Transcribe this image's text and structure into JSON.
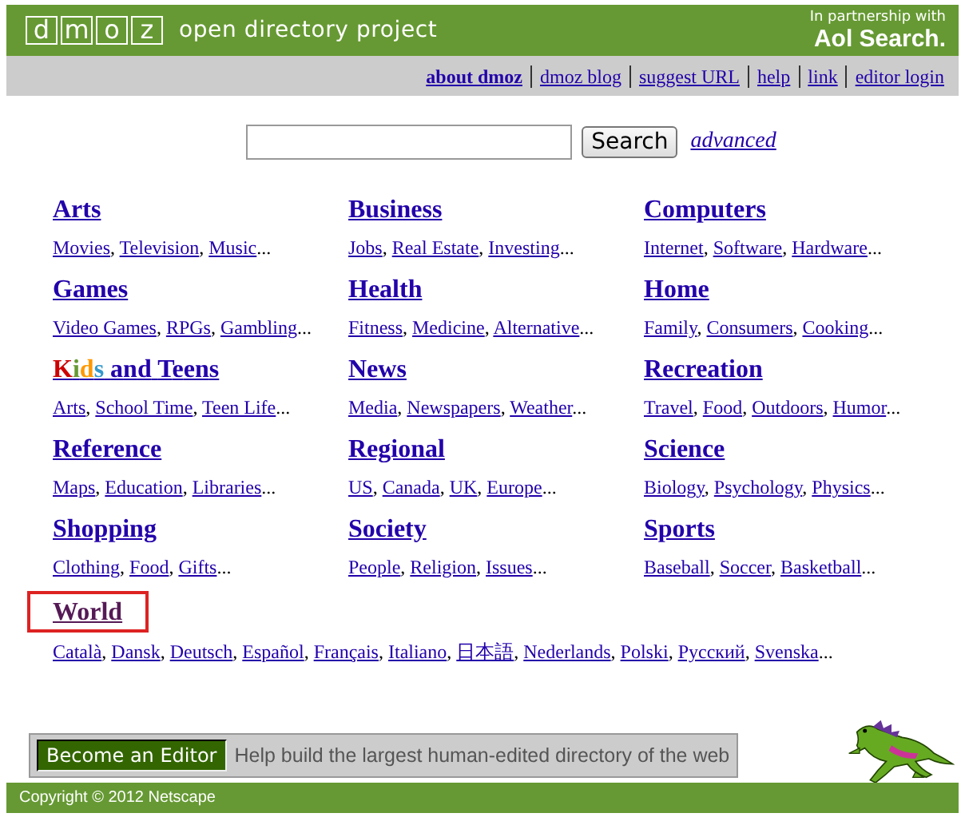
{
  "header": {
    "logo_letters": [
      "d",
      "m",
      "o",
      "z"
    ],
    "tagline": "open directory project",
    "partner_line": "In partnership with",
    "partner_brand": "Aol Search."
  },
  "nav": [
    {
      "label": "about dmoz",
      "bold": true
    },
    {
      "label": "dmoz blog",
      "bold": false
    },
    {
      "label": "suggest URL",
      "bold": false
    },
    {
      "label": "help",
      "bold": false
    },
    {
      "label": "link",
      "bold": false
    },
    {
      "label": "editor login",
      "bold": false
    }
  ],
  "search": {
    "button": "Search",
    "advanced": "advanced"
  },
  "categories": [
    {
      "title": "Arts",
      "kind": "plain",
      "subs": [
        {
          "label": "Movies",
          "after": ","
        },
        {
          "label": "Television",
          "after": ","
        },
        {
          "label": "Music",
          "after": "..."
        }
      ]
    },
    {
      "title": "Business",
      "kind": "plain",
      "subs": [
        {
          "label": "Jobs",
          "after": ","
        },
        {
          "label": "Real Estate",
          "after": ","
        },
        {
          "label": "Investing",
          "after": "..."
        }
      ]
    },
    {
      "title": "Computers",
      "kind": "plain",
      "subs": [
        {
          "label": "Internet",
          "after": ","
        },
        {
          "label": "Software",
          "after": ","
        },
        {
          "label": "Hardware",
          "after": "..."
        }
      ]
    },
    {
      "title": "Games",
      "kind": "plain",
      "subs": [
        {
          "label": "Video Games",
          "after": ","
        },
        {
          "label": "RPGs",
          "after": ","
        },
        {
          "label": "Gambling",
          "after": "..."
        }
      ]
    },
    {
      "title": "Health",
      "kind": "plain",
      "subs": [
        {
          "label": "Fitness",
          "after": ","
        },
        {
          "label": "Medicine",
          "after": ","
        },
        {
          "label": "Alternative",
          "after": "..."
        }
      ]
    },
    {
      "title": "Home",
      "kind": "plain",
      "subs": [
        {
          "label": "Family",
          "after": ","
        },
        {
          "label": "Consumers",
          "after": ","
        },
        {
          "label": "Cooking",
          "after": "..."
        }
      ]
    },
    {
      "title": "Kids and Teens",
      "kind": "rainbow",
      "subs": [
        {
          "label": "Arts",
          "after": ","
        },
        {
          "label": "School Time",
          "after": ","
        },
        {
          "label": "Teen Life",
          "after": "..."
        }
      ]
    },
    {
      "title": "News",
      "kind": "plain",
      "subs": [
        {
          "label": "Media",
          "after": ","
        },
        {
          "label": "Newspapers",
          "after": ","
        },
        {
          "label": "Weather",
          "after": "..."
        }
      ]
    },
    {
      "title": "Recreation",
      "kind": "plain",
      "subs": [
        {
          "label": "Travel",
          "after": ","
        },
        {
          "label": "Food",
          "after": ","
        },
        {
          "label": "Outdoors",
          "after": ","
        },
        {
          "label": "Humor",
          "after": "..."
        }
      ]
    },
    {
      "title": "Reference",
      "kind": "plain",
      "subs": [
        {
          "label": "Maps",
          "after": ","
        },
        {
          "label": "Education",
          "after": ","
        },
        {
          "label": "Libraries",
          "after": "..."
        }
      ]
    },
    {
      "title": "Regional",
      "kind": "plain",
      "subs": [
        {
          "label": "US",
          "after": ","
        },
        {
          "label": "Canada",
          "after": ","
        },
        {
          "label": "UK",
          "after": ","
        },
        {
          "label": "Europe",
          "after": "..."
        }
      ]
    },
    {
      "title": "Science",
      "kind": "plain",
      "subs": [
        {
          "label": "Biology",
          "after": ","
        },
        {
          "label": "Psychology",
          "after": ","
        },
        {
          "label": "Physics",
          "after": "..."
        }
      ]
    },
    {
      "title": "Shopping",
      "kind": "plain",
      "subs": [
        {
          "label": "Clothing",
          "after": ","
        },
        {
          "label": "Food",
          "after": ","
        },
        {
          "label": "Gifts",
          "after": "..."
        }
      ]
    },
    {
      "title": "Society",
      "kind": "plain",
      "subs": [
        {
          "label": "People",
          "after": ","
        },
        {
          "label": "Religion",
          "after": ","
        },
        {
          "label": "Issues",
          "after": "..."
        }
      ]
    },
    {
      "title": "Sports",
      "kind": "plain",
      "subs": [
        {
          "label": "Baseball",
          "after": ","
        },
        {
          "label": "Soccer",
          "after": ","
        },
        {
          "label": "Basketball",
          "after": "..."
        }
      ]
    }
  ],
  "world": {
    "title": "World",
    "highlighted": true,
    "subs": [
      {
        "label": "Català",
        "after": ","
      },
      {
        "label": "Dansk",
        "after": ","
      },
      {
        "label": "Deutsch",
        "after": ","
      },
      {
        "label": "Español",
        "after": ","
      },
      {
        "label": "Français",
        "after": ","
      },
      {
        "label": "Italiano",
        "after": ","
      },
      {
        "label": "日本語",
        "after": ","
      },
      {
        "label": "Nederlands",
        "after": ","
      },
      {
        "label": "Polski",
        "after": ","
      },
      {
        "label": "Русский",
        "after": ","
      },
      {
        "label": "Svenska",
        "after": "..."
      }
    ]
  },
  "editor_banner": {
    "button": "Become an Editor",
    "text": "Help build the largest human-edited directory of the web"
  },
  "footer": {
    "copyright": "Copyright © 2012 Netscape"
  }
}
